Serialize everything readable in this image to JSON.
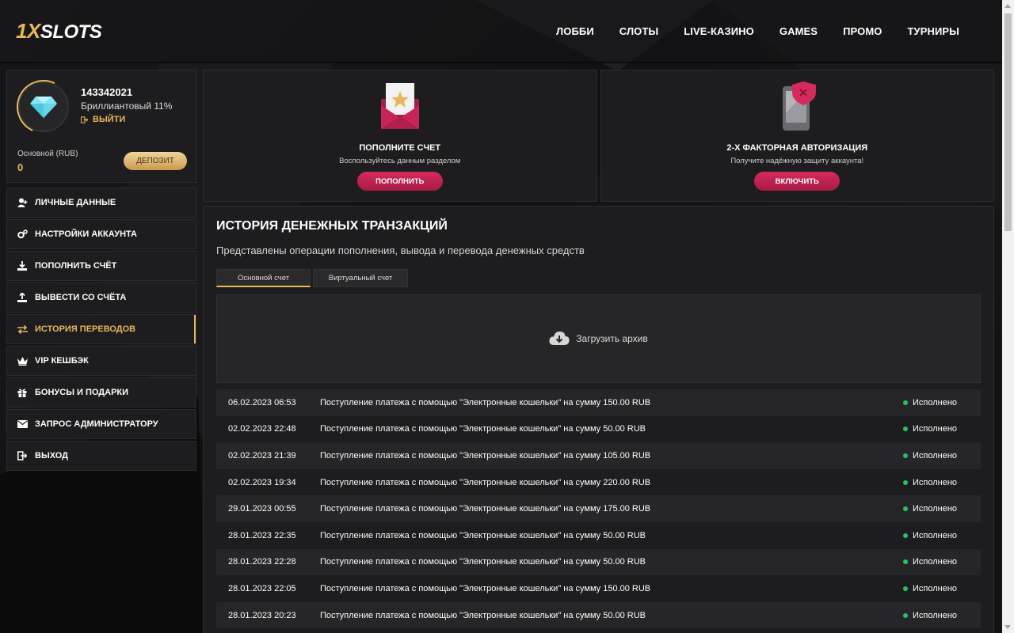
{
  "header": {
    "logo_prefix": "1X",
    "logo_rest": "SLOTS",
    "nav": [
      "ЛОББИ",
      "СЛОТЫ",
      "LIVE-КАЗИНО",
      "GAMES",
      "ПРОМО",
      "ТУРНИРЫ"
    ]
  },
  "profile": {
    "user_id": "143342021",
    "level": "Бриллиантовый 11%",
    "logout": "ВЫЙТИ",
    "balance_label": "Основной (RUB)",
    "balance_value": "0",
    "deposit_button": "ДЕПОЗИТ"
  },
  "menu": {
    "items": [
      {
        "label": "ЛИЧНЫЕ ДАННЫЕ",
        "icon": "user-add-icon"
      },
      {
        "label": "НАСТРОЙКИ АККАУНТА",
        "icon": "gears-icon"
      },
      {
        "label": "ПОПОЛНИТЬ СЧЁТ",
        "icon": "download-icon"
      },
      {
        "label": "ВЫВЕСТИ СО СЧЁТА",
        "icon": "upload-icon"
      },
      {
        "label": "ИСТОРИЯ ПЕРЕВОДОВ",
        "icon": "transfer-icon"
      },
      {
        "label": "VIP КЕШБЭК",
        "icon": "crown-icon"
      },
      {
        "label": "БОНУСЫ И ПОДАРКИ",
        "icon": "gift-icon"
      },
      {
        "label": "ЗАПРОС АДМИНИСТРАТОРУ",
        "icon": "envelope-icon"
      },
      {
        "label": "ВЫХОД",
        "icon": "exit-icon"
      }
    ],
    "active_index": 4
  },
  "cards": {
    "deposit": {
      "title": "ПОПОЛНИТЕ СЧЕТ",
      "subtitle": "Воспользуйтесь данным разделом",
      "button": "ПОПОЛНИТЬ"
    },
    "twofa": {
      "title": "2-Х ФАКТОРНАЯ АВТОРИЗАЦИЯ",
      "subtitle": "Получите надёжную защиту аккаунта!",
      "button": "ВКЛЮЧИТЬ"
    }
  },
  "history": {
    "title": "ИСТОРИЯ ДЕНЕЖНЫХ ТРАНЗАКЦИЙ",
    "description": "Представлены операции пополнения, вывода и перевода денежных средств",
    "tabs": [
      "Основной счет",
      "Виртуальный счет"
    ],
    "archive_label": "Загрузить архив",
    "rows": [
      {
        "date": "06.02.2023 06:53",
        "text": "Поступление платежа с помощью \"Электронные кошельки\" на сумму 150.00 RUB",
        "status": "Исполнено"
      },
      {
        "date": "02.02.2023 22:48",
        "text": "Поступление платежа с помощью \"Электронные кошельки\" на сумму 50.00 RUB",
        "status": "Исполнено"
      },
      {
        "date": "02.02.2023 21:39",
        "text": "Поступление платежа с помощью \"Электронные кошельки\" на сумму 105.00 RUB",
        "status": "Исполнено"
      },
      {
        "date": "02.02.2023 19:34",
        "text": "Поступление платежа с помощью \"Электронные кошельки\" на сумму 220.00 RUB",
        "status": "Исполнено"
      },
      {
        "date": "29.01.2023 00:55",
        "text": "Поступление платежа с помощью \"Электронные кошельки\" на сумму 175.00 RUB",
        "status": "Исполнено"
      },
      {
        "date": "28.01.2023 22:35",
        "text": "Поступление платежа с помощью \"Электронные кошельки\" на сумму 50.00 RUB",
        "status": "Исполнено"
      },
      {
        "date": "28.01.2023 22:28",
        "text": "Поступление платежа с помощью \"Электронные кошельки\" на сумму 50.00 RUB",
        "status": "Исполнено"
      },
      {
        "date": "28.01.2023 22:05",
        "text": "Поступление платежа с помощью \"Электронные кошельки\" на сумму 150.00 RUB",
        "status": "Исполнено"
      },
      {
        "date": "28.01.2023 20:23",
        "text": "Поступление платежа с помощью \"Электронные кошельки\" на сумму 50.00 RUB",
        "status": "Исполнено"
      }
    ]
  },
  "colors": {
    "accent_gold": "#e6b85a",
    "accent_pink": "#d42a5c",
    "status_green": "#1fc56a"
  }
}
